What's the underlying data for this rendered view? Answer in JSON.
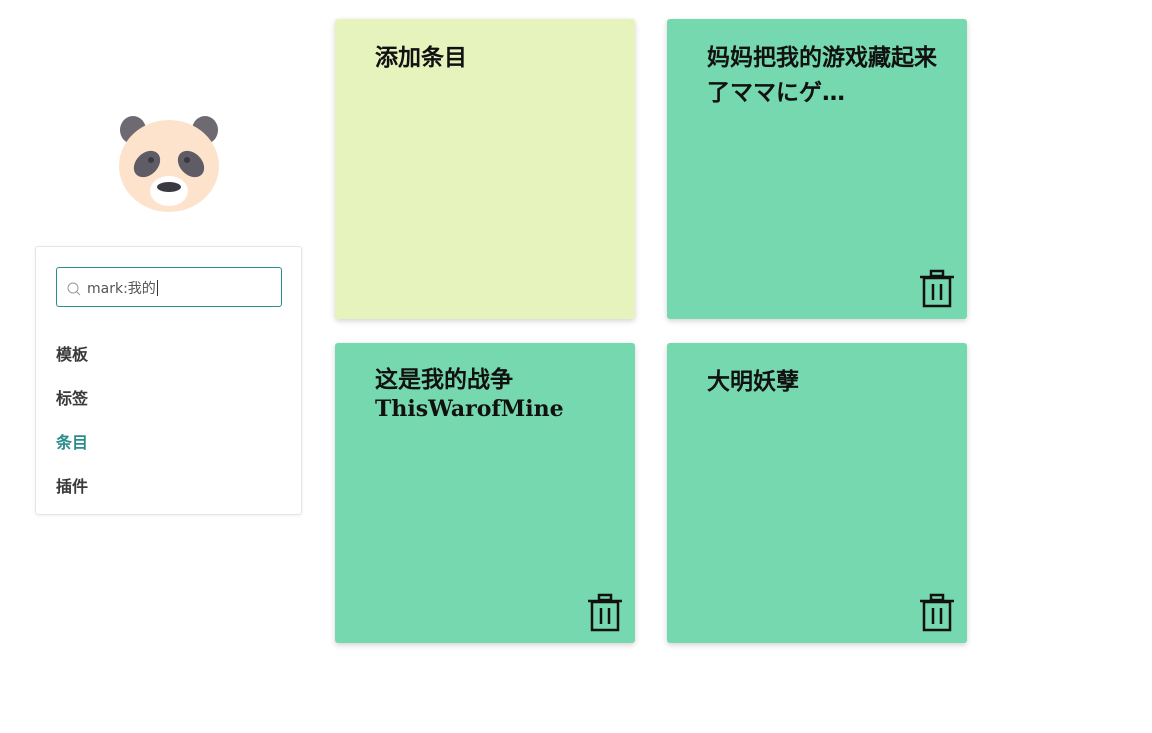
{
  "search": {
    "value": "mark:我的"
  },
  "menu": [
    {
      "label": "模板",
      "active": false
    },
    {
      "label": "标签",
      "active": false
    },
    {
      "label": "条目",
      "active": true
    },
    {
      "label": "插件",
      "active": false
    }
  ],
  "cards": [
    {
      "title": "添加条目",
      "color": "#e7f3bd",
      "deletable": false
    },
    {
      "title": "妈妈把我的游戏藏起来了ママにゲ…",
      "color": "#75d8ae",
      "deletable": true
    },
    {
      "title": "这是我的战争",
      "subtitle": "ThisWarofMine",
      "color": "#75d8ae",
      "deletable": true
    },
    {
      "title": "大明妖孽",
      "color": "#75d8ae",
      "deletable": true
    }
  ],
  "colors": {
    "accent": "#2a8d8a",
    "card_green": "#75d8ae",
    "card_lime": "#e7f3bd"
  },
  "icons": {
    "logo": "panda-icon",
    "search": "search-icon",
    "delete": "trash-icon"
  }
}
